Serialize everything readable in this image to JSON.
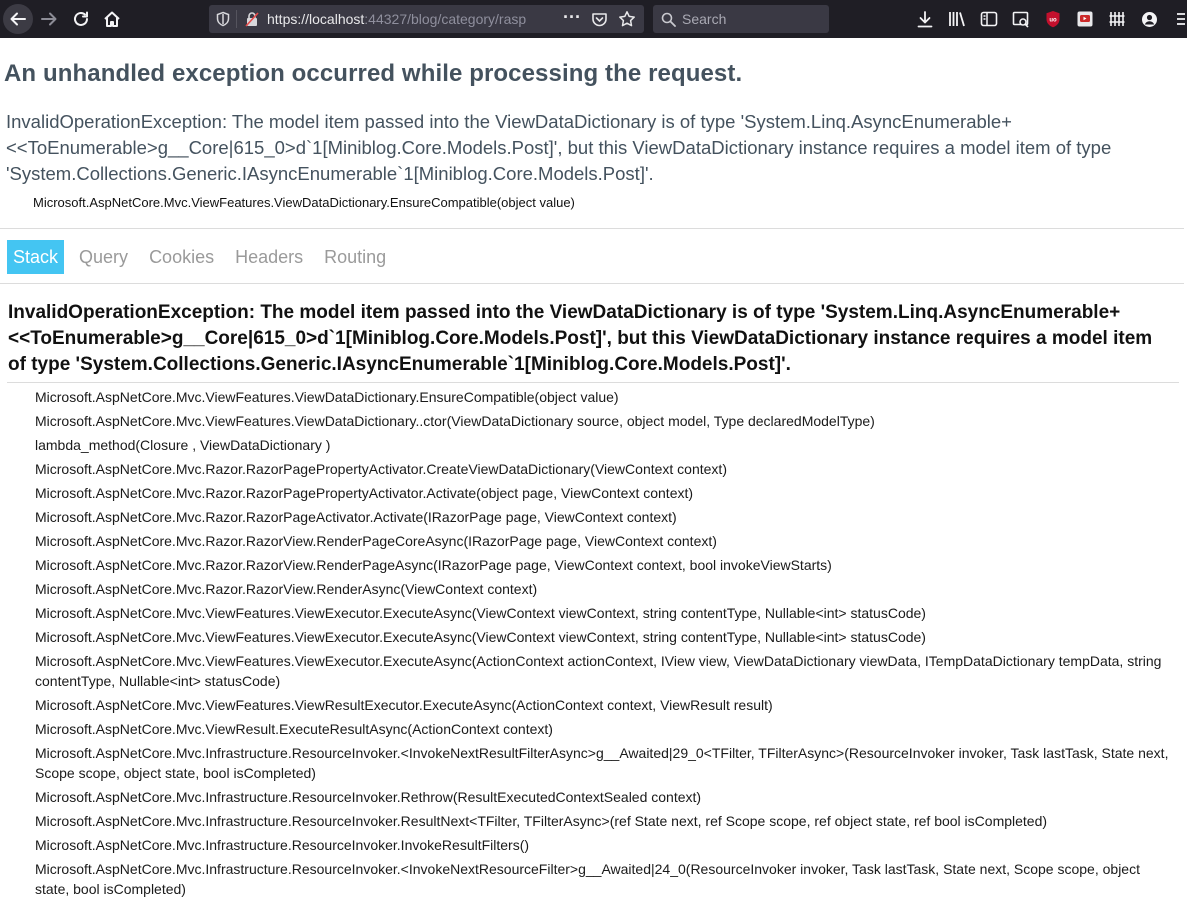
{
  "browser": {
    "url_host": "https://localhost",
    "url_rest": ":44327/blog/category/rasp",
    "search_placeholder": "Search",
    "page_actions_icon": "ellipsis-icon",
    "pocket_icon": "pocket-icon",
    "bookmark_icon": "star-icon"
  },
  "error": {
    "title": "An unhandled exception occurred while processing the request.",
    "summary": "InvalidOperationException: The model item passed into the ViewDataDictionary is of type 'System.Linq.AsyncEnumerable+<<ToEnumerable>g__Core|615_0>d`1[Miniblog.Core.Models.Post]', but this ViewDataDictionary instance requires a model item of type 'System.Collections.Generic.IAsyncEnumerable`1[Miniblog.Core.Models.Post]'.",
    "location": "Microsoft.AspNetCore.Mvc.ViewFeatures.ViewDataDictionary.EnsureCompatible(object value)"
  },
  "tabs": [
    {
      "label": "Stack",
      "active": true
    },
    {
      "label": "Query",
      "active": false
    },
    {
      "label": "Cookies",
      "active": false
    },
    {
      "label": "Headers",
      "active": false
    },
    {
      "label": "Routing",
      "active": false
    }
  ],
  "stack": {
    "title": "InvalidOperationException: The model item passed into the ViewDataDictionary is of type 'System.Linq.AsyncEnumerable+<<ToEnumerable>g__Core|615_0>d`1[Miniblog.Core.Models.Post]', but this ViewDataDictionary instance requires a model item of type 'System.Collections.Generic.IAsyncEnumerable`1[Miniblog.Core.Models.Post]'.",
    "frames": [
      "Microsoft.AspNetCore.Mvc.ViewFeatures.ViewDataDictionary.EnsureCompatible(object value)",
      "Microsoft.AspNetCore.Mvc.ViewFeatures.ViewDataDictionary..ctor(ViewDataDictionary source, object model, Type declaredModelType)",
      "lambda_method(Closure , ViewDataDictionary )",
      "Microsoft.AspNetCore.Mvc.Razor.RazorPagePropertyActivator.CreateViewDataDictionary(ViewContext context)",
      "Microsoft.AspNetCore.Mvc.Razor.RazorPagePropertyActivator.Activate(object page, ViewContext context)",
      "Microsoft.AspNetCore.Mvc.Razor.RazorPageActivator.Activate(IRazorPage page, ViewContext context)",
      "Microsoft.AspNetCore.Mvc.Razor.RazorView.RenderPageCoreAsync(IRazorPage page, ViewContext context)",
      "Microsoft.AspNetCore.Mvc.Razor.RazorView.RenderPageAsync(IRazorPage page, ViewContext context, bool invokeViewStarts)",
      "Microsoft.AspNetCore.Mvc.Razor.RazorView.RenderAsync(ViewContext context)",
      "Microsoft.AspNetCore.Mvc.ViewFeatures.ViewExecutor.ExecuteAsync(ViewContext viewContext, string contentType, Nullable<int> statusCode)",
      "Microsoft.AspNetCore.Mvc.ViewFeatures.ViewExecutor.ExecuteAsync(ViewContext viewContext, string contentType, Nullable<int> statusCode)",
      "Microsoft.AspNetCore.Mvc.ViewFeatures.ViewExecutor.ExecuteAsync(ActionContext actionContext, IView view, ViewDataDictionary viewData, ITempDataDictionary tempData, string contentType, Nullable<int> statusCode)",
      "Microsoft.AspNetCore.Mvc.ViewFeatures.ViewResultExecutor.ExecuteAsync(ActionContext context, ViewResult result)",
      "Microsoft.AspNetCore.Mvc.ViewResult.ExecuteResultAsync(ActionContext context)",
      "Microsoft.AspNetCore.Mvc.Infrastructure.ResourceInvoker.<InvokeNextResultFilterAsync>g__Awaited|29_0<TFilter, TFilterAsync>(ResourceInvoker invoker, Task lastTask, State next, Scope scope, object state, bool isCompleted)",
      "Microsoft.AspNetCore.Mvc.Infrastructure.ResourceInvoker.Rethrow(ResultExecutedContextSealed context)",
      "Microsoft.AspNetCore.Mvc.Infrastructure.ResourceInvoker.ResultNext<TFilter, TFilterAsync>(ref State next, ref Scope scope, ref object state, ref bool isCompleted)",
      "Microsoft.AspNetCore.Mvc.Infrastructure.ResourceInvoker.InvokeResultFilters()",
      "Microsoft.AspNetCore.Mvc.Infrastructure.ResourceInvoker.<InvokeNextResourceFilter>g__Awaited|24_0(ResourceInvoker invoker, Task lastTask, State next, Scope scope, object state, bool isCompleted)"
    ]
  },
  "colors": {
    "chrome_bg": "#1f1e25",
    "tab_active": "#44c5f2",
    "title_text": "#44525e",
    "adblock_red": "#c3102d"
  }
}
